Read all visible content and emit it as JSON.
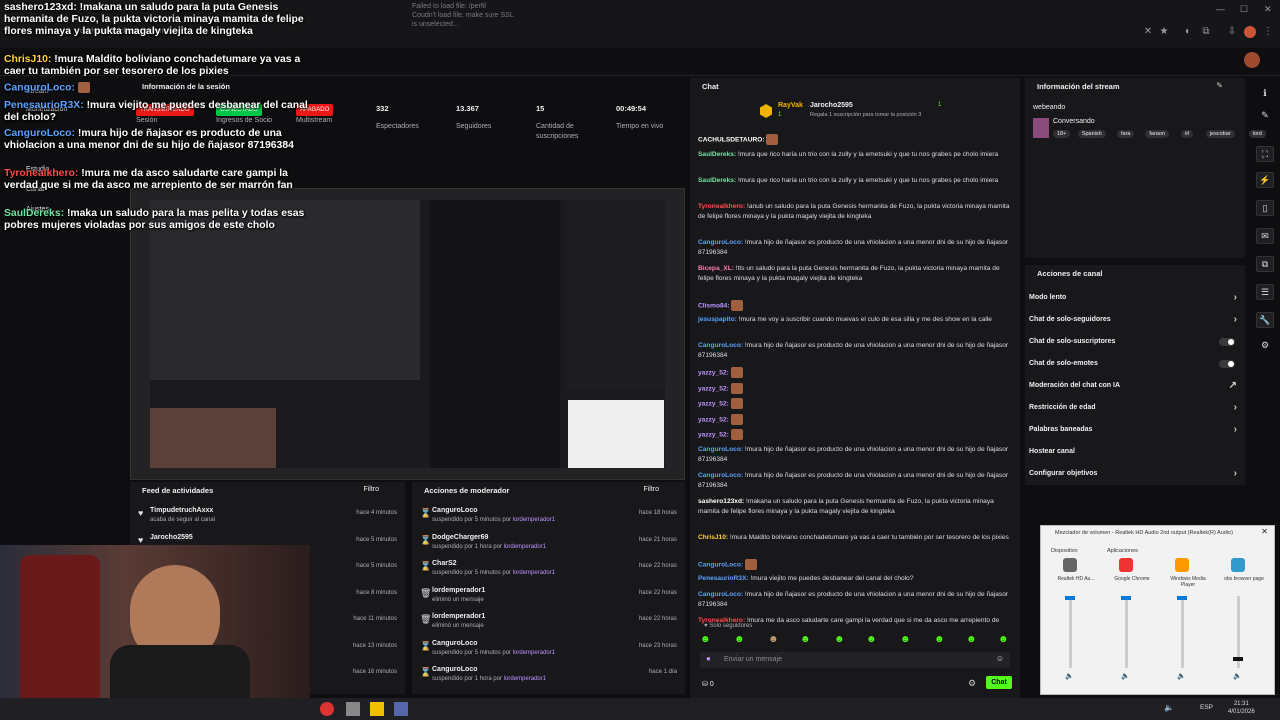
{
  "browser": {
    "address": "dashboard.kick.com/stream",
    "window_note": [
      "Failed to load file: /perfil",
      "Coudn't load file, make sure SSL",
      "is unselected..."
    ],
    "clock_time": "21:31",
    "clock_date": "4/01/2026",
    "language": "ESP"
  },
  "overlay_chat": [
    {
      "user": "sashero123xd",
      "color": "#ffffff",
      "text": "!makana un saludo para la puta Genesis hermanita de Fuzo, la pukta victoria minaya mamita de felipe flores minaya y la pukta magaly viejita de kingteka"
    },
    {
      "user": "ChrisJ10",
      "color": "#ffd33b",
      "text": "!mura Maldito boliviano conchadetumare ya vas a caer tu también por ser tesorero de los pixies"
    },
    {
      "user": "CanguroLoco",
      "color": "#5aa2ff",
      "text": ""
    },
    {
      "user": "PenesaurioR3X",
      "color": "#5aa2ff",
      "text": "!mura viejito me puedes desbanear del canal del cholo?"
    },
    {
      "user": "CanguroLoco",
      "color": "#5aa2ff",
      "text": "!mura hijo de ñajasor es producto de una vhiolacion a una menor dni de su hijo de ñajasor 87196384"
    },
    {
      "user": "Tyronealkhero",
      "color": "#ff4b4b",
      "text": "!mura me da asco saludarte care gampi la verdad que si me da asco me arrepiento de ser marrón fan"
    },
    {
      "user": "SaulDereks",
      "color": "#72e3a0",
      "text": "!maka un saludo para la mas pelita y todas esas pobres mujeres violadas por sus amigos de este cholo"
    }
  ],
  "sidemenu": [
    "Monetización",
    "Estudio",
    "Canal",
    "Stream",
    "Ajustes"
  ],
  "session": {
    "title": "Información de la sesión",
    "badges": [
      "TRANSMITIENDO",
      "CONECTADO",
      "APAGADO"
    ],
    "badge_labels": [
      "Sesión",
      "Ingresos de Socio",
      "Multistream"
    ],
    "stats": [
      {
        "value": "332",
        "label": "Espectadores"
      },
      {
        "value": "13.367",
        "label": "Seguidores"
      },
      {
        "value": "15",
        "label": "Cantidad de suscripciones"
      },
      {
        "value": "00:49:54",
        "label": "Tiempo en vivo"
      }
    ]
  },
  "activity": {
    "title": "Feed de actividades",
    "filter": "Filtro",
    "rows": [
      {
        "name": "TimpudetruchAxxx",
        "sub": "acaba de seguir al canal",
        "time": "hace 4 minutos"
      },
      {
        "name": "Jarocho2595",
        "sub": "",
        "time": "hace 5 minutos"
      },
      {
        "name": "",
        "sub": "",
        "time": "hace 5 minutos"
      },
      {
        "name": "",
        "sub": "",
        "time": "hace 8 minutos"
      },
      {
        "name": "",
        "sub": "",
        "time": "hace 11 minutos"
      },
      {
        "name": "",
        "sub": "",
        "time": "hace 13 minutos"
      },
      {
        "name": "",
        "sub": "",
        "time": "hace 16 minutos"
      }
    ]
  },
  "mod": {
    "title": "Acciones de moderador",
    "filter": "Filtro",
    "by": "lordemperador1",
    "rows": [
      {
        "icon": "⌛",
        "name": "CanguroLoco",
        "sub": "suspendido por 5 minutos por",
        "time": "hace 18 horas"
      },
      {
        "icon": "⌛",
        "name": "DodgeCharger69",
        "sub": "suspendido por 1 hora por",
        "time": "hace 21 horas"
      },
      {
        "icon": "⌛",
        "name": "CharS2",
        "sub": "suspendido por 5 minutos por",
        "time": "hace 22 horas"
      },
      {
        "icon": "🗑",
        "name": "lordemperador1",
        "sub": "eliminó un mensaje",
        "time": "hace 22 horas"
      },
      {
        "icon": "🗑",
        "name": "lordemperador1",
        "sub": "eliminó un mensaje",
        "time": "hace 22 horas"
      },
      {
        "icon": "⌛",
        "name": "CanguroLoco",
        "sub": "suspendido por 5 minutos por",
        "time": "hace 23 horas"
      },
      {
        "icon": "⌛",
        "name": "CanguroLoco",
        "sub": "suspendido por 1 hora por",
        "time": "hace 1 día"
      }
    ]
  },
  "chat": {
    "title": "Chat",
    "pin_user": "RayVak",
    "pin_count": "1",
    "pin_gift_user": "Jarocho2595",
    "pin_gift_count": "1",
    "pin_gift_text": "Regala 1 suscripción para tomar la posición 3",
    "messages": [
      {
        "user": "CACHULSDETAURO",
        "color": "#ffffff",
        "text": "",
        "emote": true
      },
      {
        "user": "SaulDereks",
        "color": "#72e3a0",
        "text": "!mura que rico haría un trio con la zully y la emetsuki y que tu nos grabes pe cholo imiera"
      },
      {
        "user": "SaulDereks",
        "color": "#72e3a0",
        "text": "!mura que rico haría un trio con la zully y la emetsuki y que tu nos grabes pe cholo imiera"
      },
      {
        "user": "Tyronealkhero",
        "color": "#ff4b4b",
        "text": "!anub un saludo para la puta Genesis hermanita de Fuzo, la pukta victoria minaya mamita de felipe flores minaya y la pukta magaly viejita de kingteka"
      },
      {
        "user": "CanguroLoco",
        "color": "#5aa2ff",
        "text": "!mura hijo de ñajasor es producto de una vhiolacion a una menor dni de su hijo de ñajasor 87196384"
      },
      {
        "user": "Bicepa_XL",
        "color": "#ff7bb0",
        "text": "!tts un saludo para la puta Genesis hermanita de Fuzo, la pukta victoria minaya mamita de felipe flores minaya y la pukta magaly viejita de kingteka"
      },
      {
        "user": "Clismo84",
        "color": "#bf94ff",
        "text": "",
        "emote": true
      },
      {
        "user": "jesuspapito",
        "color": "#5aa2ff",
        "text": "!mura me voy a suscribir cuando muevas el culo de esa silla y me des show en la calle"
      },
      {
        "user": "CanguroLoco",
        "color": "#5aa2ff",
        "text": "!mura hijo de ñajasor es producto de una vhiolacion a una menor dni de su hijo de ñajasor 87196384"
      },
      {
        "user": "yazzy_52",
        "color": "#bf94ff",
        "text": "",
        "emote": true
      },
      {
        "user": "yazzy_52",
        "color": "#bf94ff",
        "text": "",
        "emote": true
      },
      {
        "user": "yazzy_52",
        "color": "#bf94ff",
        "text": "",
        "emote": true
      },
      {
        "user": "yazzy_52",
        "color": "#bf94ff",
        "text": "",
        "emote": true
      },
      {
        "user": "yazzy_52",
        "color": "#bf94ff",
        "text": "",
        "emote": true
      },
      {
        "user": "CanguroLoco",
        "color": "#5aa2ff",
        "text": "!mura hijo de ñajasor es producto de una vhiolacion a una menor dni de su hijo de ñajasor 87196384"
      },
      {
        "user": "CanguroLoco",
        "color": "#5aa2ff",
        "text": "!mura hijo de ñajasor es producto de una vhiolacion a una menor dni de su hijo de ñajasor 87196384"
      },
      {
        "user": "sashero123xd",
        "color": "#ffffff",
        "text": "!makana un saludo para la puta Genesis hermanita de Fuzo, la pukta victoria minaya mamita de felipe flores minaya y la pukta magaly viejita de kingteka"
      },
      {
        "user": "ChrisJ10",
        "color": "#ffd33b",
        "text": "!mura Maldito boliviano conchadetumare ya vas a caer tu también por ser tesorero de los pixies"
      },
      {
        "user": "CanguroLoco",
        "color": "#5aa2ff",
        "text": "",
        "emote": true
      },
      {
        "user": "PenesaurioR3X",
        "color": "#5aa2ff",
        "text": "!mura viejito me puedes desbanear del canal del cholo?"
      },
      {
        "user": "CanguroLoco",
        "color": "#5aa2ff",
        "text": "!mura hijo de ñajasor es producto de una vhiolacion a una menor dni de su hijo de ñajasor 87196384"
      },
      {
        "user": "Tyronealkhero",
        "color": "#ff4b4b",
        "text": "!mura me da asco saludarte care gampi la verdad que si me da asco me arrepiento de ser marrón fan"
      },
      {
        "user": "SaulDereks",
        "color": "#72e3a0",
        "text": "!maka un saludo para la mas pelita y todas esas pobres mujeres violadas por sus amigos de este cholo"
      }
    ],
    "followers_only": "Solo seguidores",
    "input_placeholder": "Enviar un mensaje",
    "points": "0",
    "send_label": "Chat"
  },
  "stream_info": {
    "title": "Información del stream",
    "stream_title": "webeando",
    "category": "Conversando",
    "tags": [
      "18+",
      "Spanish",
      "fara",
      "faraon",
      "irl",
      "jescobar",
      "lord"
    ]
  },
  "channel_actions": {
    "title": "Acciones de canal",
    "items": [
      {
        "label": "Modo lento",
        "type": "arrow"
      },
      {
        "label": "Chat de solo-seguidores",
        "type": "arrow"
      },
      {
        "label": "Chat de solo-suscriptores",
        "type": "toggle"
      },
      {
        "label": "Chat de solo-emotes",
        "type": "toggle"
      },
      {
        "label": "Moderación del chat con IA",
        "type": "external"
      },
      {
        "label": "Restricción de edad",
        "type": "arrow"
      },
      {
        "label": "Palabras baneadas",
        "type": "arrow"
      },
      {
        "label": "Hostear canal",
        "type": "none"
      },
      {
        "label": "Configurar objetivos",
        "type": "arrow"
      }
    ]
  },
  "mixer": {
    "title": "Mezclador de volumen - Realtek HD Audio 2nd output (Realtek(R) Audio)",
    "device_label": "Dispositivo",
    "apps_label": "Aplicaciones",
    "channels": [
      {
        "name": "Realtek HD Au...",
        "level": 0.0
      },
      {
        "name": "Google Chrome",
        "level": 0.0
      },
      {
        "name": "Windows Media Player",
        "level": 0.0
      },
      {
        "name": "obs browser page",
        "level": 0.85
      }
    ]
  },
  "colors": {
    "kick_green": "#53fc18",
    "accent_purple": "#bf94ff",
    "live_red": "#e91916"
  }
}
